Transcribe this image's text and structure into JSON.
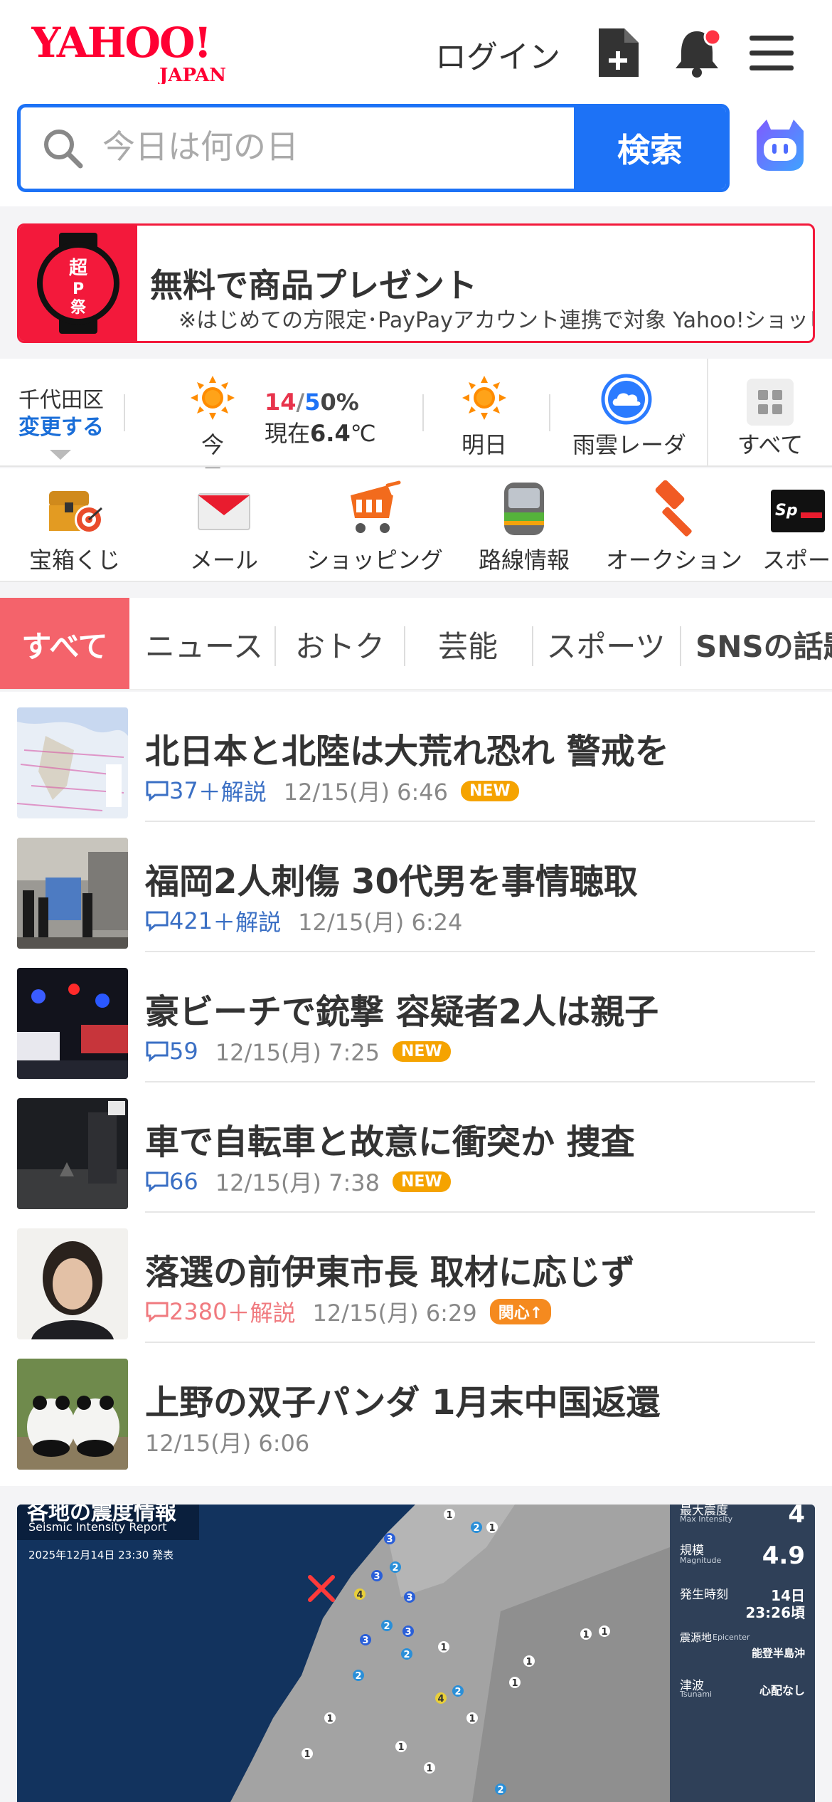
{
  "header": {
    "logo_text": "YAHOO!",
    "logo_sub": "JAPAN",
    "login_label": "ログイン",
    "search_placeholder": "今日は何の日",
    "search_button": "検索",
    "icons": [
      "document-plus-icon",
      "bell-icon",
      "hamburger-menu-icon",
      "ai-assistant-icon"
    ]
  },
  "promo": {
    "badge_text": "超PayPay祭",
    "title": "無料で商品プレゼント",
    "subtitle": "※はじめての方限定･PayPayアカウント連携で対象 Yahoo!ショッピング"
  },
  "weather": {
    "location": "千代田区",
    "change_label": "変更する",
    "today_label": "今日",
    "high": "14",
    "slash": "/",
    "low": "5",
    "precip": "0%",
    "now_prefix": "現在",
    "now_temp": "6.4",
    "now_unit": "℃",
    "tomorrow_label": "明日",
    "radar_label": "雨雲レーダー",
    "all_label": "すべて",
    "colors": {
      "high": "#e8344c",
      "low": "#1d72f6"
    }
  },
  "services": [
    {
      "label": "宝箱くじ",
      "icon": "treasure-box-icon"
    },
    {
      "label": "メール",
      "icon": "mail-icon"
    },
    {
      "label": "ショッピング",
      "icon": "shopping-cart-icon"
    },
    {
      "label": "路線情報",
      "icon": "train-icon"
    },
    {
      "label": "オークション",
      "icon": "auction-hammer-icon"
    },
    {
      "label": "スポーツ",
      "icon": "sports-icon"
    }
  ],
  "tabs": [
    {
      "label": "すべて",
      "active": true
    },
    {
      "label": "ニュース"
    },
    {
      "label": "おトク"
    },
    {
      "label": "芸能"
    },
    {
      "label": "スポーツ"
    },
    {
      "label": "SNSの話題"
    }
  ],
  "news": [
    {
      "title": "北日本と北陸は大荒れ恐れ 警戒を",
      "comments": "37",
      "extra": "＋解説",
      "time": "12/15(月) 6:46",
      "badge": "NEW"
    },
    {
      "title": "福岡2人刺傷 30代男を事情聴取",
      "comments": "421",
      "extra": "＋解説",
      "time": "12/15(月) 6:24",
      "badge": ""
    },
    {
      "title": "豪ビーチで銃撃 容疑者2人は親子",
      "comments": "59",
      "extra": "",
      "time": "12/15(月) 7:25",
      "badge": "NEW"
    },
    {
      "title": "車で自転車と故意に衝突か 捜査",
      "comments": "66",
      "extra": "",
      "time": "12/15(月) 7:38",
      "badge": "NEW"
    },
    {
      "title": "落選の前伊東市長 取材に応じず",
      "comments": "2380",
      "extra": "＋解説",
      "time": "12/15(月) 6:29",
      "badge": "関心↑"
    },
    {
      "title": "上野の双子パンダ 1月末中国返還",
      "comments": "",
      "extra": "",
      "time": "12/15(月) 6:06",
      "badge": ""
    }
  ],
  "map": {
    "title": "各地の震度情報",
    "subtitle": "Seismic Intensity Report",
    "issued": "2025年12月14日 23:30 発表",
    "max_intensity_label": "最大震度",
    "max_intensity_sub": "Max Intensity",
    "max_intensity": "4",
    "magnitude_label": "規模",
    "magnitude_sub": "Magnitude",
    "magnitude": "4.9",
    "time_label": "発生時刻",
    "time_day": "14日",
    "time_value": "23:26頃",
    "epicenter_label": "震源地",
    "epicenter_sub": "Epicenter",
    "epicenter": "能登半島沖",
    "tsunami_label": "津波",
    "tsunami_sub": "Tsunami",
    "tsunami": "心配なし"
  }
}
